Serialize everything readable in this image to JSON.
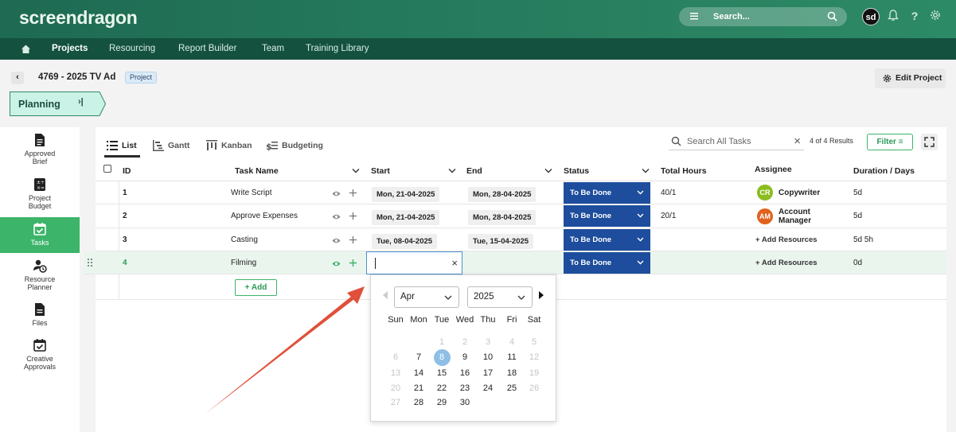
{
  "app": {
    "logo_main": "screen",
    "logo_accent": "dragon"
  },
  "topbar": {
    "search_label": "Search...",
    "avatar_initials": "sd"
  },
  "nav": {
    "items": [
      "Projects",
      "Resourcing",
      "Report Builder",
      "Team",
      "Training Library"
    ]
  },
  "project": {
    "title": "4769 - 2025 TV Ad",
    "badge": "Project",
    "edit_label": "Edit Project",
    "stage": "Planning",
    "stage_icon": "›|"
  },
  "sidebar": {
    "items": [
      {
        "label1": "Approved",
        "label2": "Brief",
        "icon": "document-icon"
      },
      {
        "label1": "Project",
        "label2": "Budget",
        "icon": "calculator-icon"
      },
      {
        "label1": "Tasks",
        "label2": "",
        "icon": "calendar-check-icon"
      },
      {
        "label1": "Resource",
        "label2": "Planner",
        "icon": "resource-clock-icon"
      },
      {
        "label1": "Files",
        "label2": "",
        "icon": "file-icon"
      },
      {
        "label1": "Creative",
        "label2": "Approvals",
        "icon": "calendar-check-icon"
      }
    ]
  },
  "views": {
    "tabs": [
      "List",
      "Gantt",
      "Kanban",
      "Budgeting"
    ]
  },
  "toolbar": {
    "search_placeholder": "Search All Tasks",
    "results": "4 of 4 Results",
    "filter_label": "Filter"
  },
  "table": {
    "headers": {
      "id": "ID",
      "task": "Task Name",
      "start": "Start",
      "end": "End",
      "status": "Status",
      "hours": "Total Hours",
      "assignee": "Assignee",
      "duration": "Duration / Days"
    },
    "rows": [
      {
        "id": "1",
        "name": "Write Script",
        "start": "Mon, 21-04-2025",
        "end": "Mon, 28-04-2025",
        "status": "To Be Done",
        "hours": "40/1",
        "assignee": "Copywriter",
        "assignee2": "",
        "initials": "CR",
        "duration": "5d"
      },
      {
        "id": "2",
        "name": "Approve Expenses",
        "start": "Mon, 21-04-2025",
        "end": "Mon, 28-04-2025",
        "status": "To Be Done",
        "hours": "20/1",
        "assignee": "Account",
        "assignee2": "Manager",
        "initials": "AM",
        "duration": "5d"
      },
      {
        "id": "3",
        "name": "Casting",
        "start": "Tue, 08-04-2025",
        "end": "Tue, 15-04-2025",
        "status": "To Be Done",
        "hours": "",
        "assignee": "+ Add Resources",
        "duration": "5d 5h"
      },
      {
        "id": "4",
        "name": "Filming",
        "start": "",
        "end": "",
        "status": "To Be Done",
        "hours": "",
        "assignee": "+ Add Resources",
        "duration": "0d"
      }
    ],
    "add_label": "+ Add"
  },
  "calendar": {
    "month": "Apr",
    "year": "2025",
    "weekdays": [
      "Sun",
      "Mon",
      "Tue",
      "Wed",
      "Thu",
      "Fri",
      "Sat"
    ],
    "weeks": [
      [
        "",
        "",
        "1",
        "2",
        "3",
        "4",
        "5"
      ],
      [
        "6",
        "7",
        "8",
        "9",
        "10",
        "11",
        "12"
      ],
      [
        "13",
        "14",
        "15",
        "16",
        "17",
        "18",
        "19"
      ],
      [
        "20",
        "21",
        "22",
        "23",
        "24",
        "25",
        "26"
      ],
      [
        "27",
        "28",
        "29",
        "30",
        "",
        "",
        ""
      ]
    ],
    "selected_day": "8"
  },
  "colors": {
    "brand_green": "#3cb46a",
    "status_blue": "#1d4d9c",
    "topbar": "#257a5d",
    "annotation_arrow": "#e0503a"
  }
}
